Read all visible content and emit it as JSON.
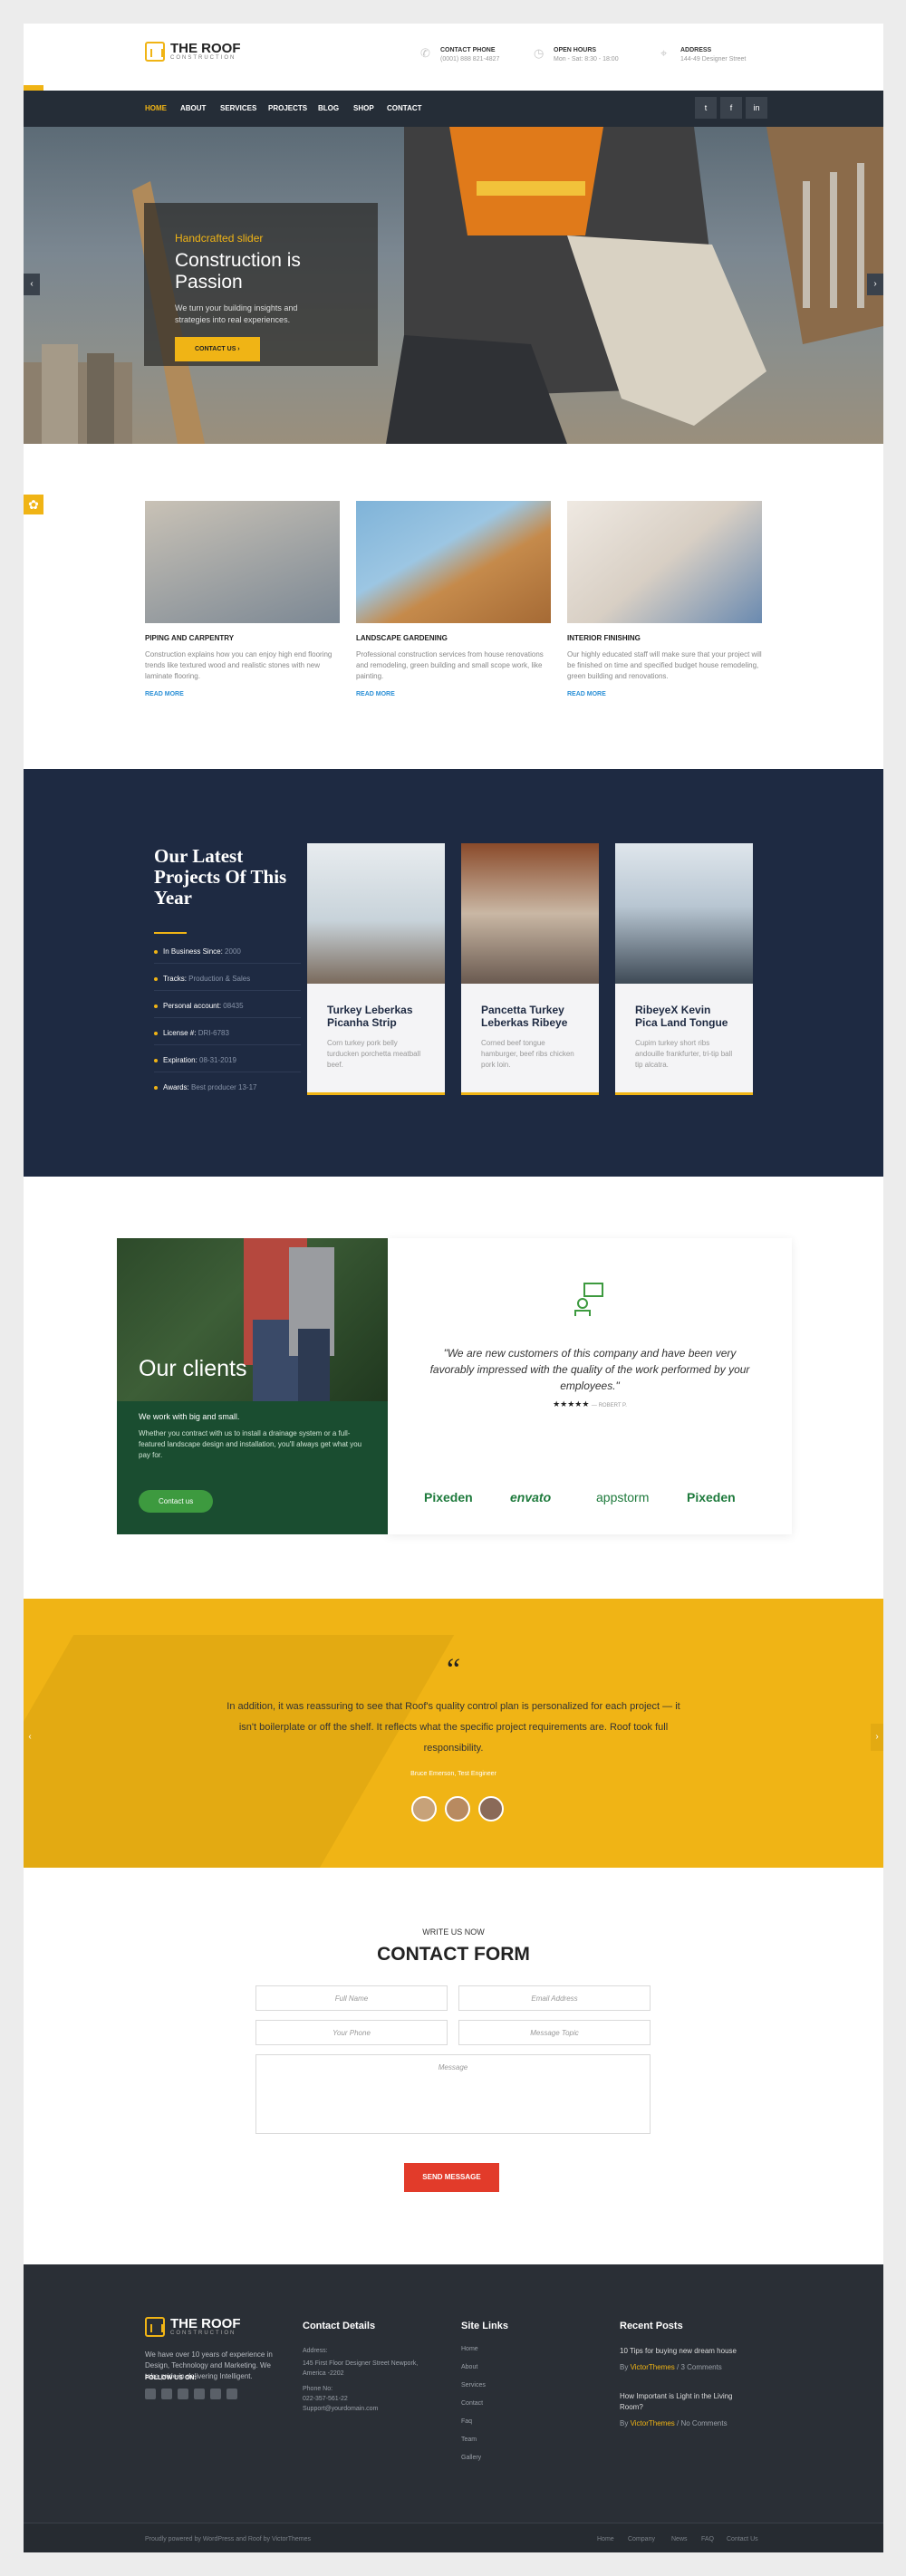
{
  "brand": {
    "name": "THE ROOF",
    "tagline": "CONSTRUCTION",
    "colors": {
      "accent": "#f0b415",
      "dark": "#252d37",
      "navy": "#1e2a42",
      "green": "#1a4d30",
      "red": "#e23b2a"
    }
  },
  "topinfo": [
    {
      "icon": "phone-icon",
      "label": "CONTACT PHONE",
      "value": "(0001) 888 821-4827"
    },
    {
      "icon": "clock-icon",
      "label": "OPEN HOURS",
      "value": "Mon - Sat: 8:30 - 18:00"
    },
    {
      "icon": "location-icon",
      "label": "ADDRESS",
      "value": "144-49 Designer Street"
    }
  ],
  "nav": {
    "items": [
      "HOME",
      "ABOUT",
      "SERVICES",
      "PROJECTS",
      "BLOG",
      "SHOP",
      "CONTACT"
    ],
    "active": "HOME",
    "social": [
      "twitter-icon",
      "facebook-icon",
      "linkedin-icon"
    ]
  },
  "hero": {
    "subtitle": "Handcrafted slider",
    "title": "Construction is Passion",
    "text": "We turn your building insights and strategies into real experiences.",
    "button": "CONTACT US ›"
  },
  "services": [
    {
      "title": "PIPING AND CARPENTRY",
      "text": "Construction explains how you can enjoy high end flooring trends like textured wood and realistic stones with new laminate flooring.",
      "more": "READ MORE"
    },
    {
      "title": "LANDSCAPE GARDENING",
      "text": "Professional construction services from house renovations and remodeling, green building and small scope work, like painting.",
      "more": "READ MORE"
    },
    {
      "title": "INTERIOR FINISHING",
      "text": "Our highly educated staff will make sure that your project will be finished on time and specified budget house remodeling, green building and renovations.",
      "more": "READ MORE"
    }
  ],
  "projects": {
    "title": "Our Latest Projects Of This Year",
    "stats": [
      {
        "label": "In Business Since:",
        "value": "2000"
      },
      {
        "label": "Tracks:",
        "value": "Production & Sales"
      },
      {
        "label": "Personal account:",
        "value": "08435"
      },
      {
        "label": "License #:",
        "value": "DRI-6783"
      },
      {
        "label": "Expiration:",
        "value": "08-31-2019"
      },
      {
        "label": "Awards:",
        "value": "Best producer 13-17"
      }
    ],
    "cards": [
      {
        "title": "Turkey Leberkas Picanha Strip",
        "text": "Corn turkey pork belly turducken porchetta meatball beef."
      },
      {
        "title": "Pancetta Turkey Leberkas Ribeye",
        "text": "Corned beef tongue hamburger, beef ribs chicken pork loin."
      },
      {
        "title": "RibeyeX Kevin Pica Land Tongue",
        "text": "Cupim turkey short ribs andouille frankfurter, tri-tip ball tip alcatra."
      }
    ]
  },
  "clients": {
    "title": "Our clients",
    "subtitle": "We work with big and small.",
    "text": "Whether you contract with us to install a drainage system or a full-featured landscape design and installation, you'll always get what you pay for.",
    "button": "Contact us",
    "quote": "\"We are new customers of this company and have been very favorably impressed with the quality of the work performed by your employees.\"",
    "stars": "★★★★★",
    "author": "— ROBERT P.",
    "logos": [
      "Pixeden",
      "envato",
      "appstorm",
      "Pixeden"
    ]
  },
  "testimonial": {
    "mark": "“",
    "text": "In addition, it was reassuring to see that Roof's quality control plan is personalized for each project — it isn't boilerplate or off the shelf. It reflects what the specific project requirements are. Roof took full responsibility.",
    "name": "Bruce Emerson, Test Engineer"
  },
  "contact": {
    "subtitle": "WRITE US NOW",
    "title": "CONTACT FORM",
    "fields": {
      "name": "Full Name",
      "email": "Email Address",
      "phone": "Your Phone",
      "topic": "Message Topic",
      "message": "Message"
    },
    "button": "SEND MESSAGE"
  },
  "footer": {
    "about": "We have over 10 years of experience in Design, Technology and Marketing. We take pride in delivering Intelligent.",
    "follow": "FOLLOW US ON:",
    "contact_title": "Contact Details",
    "address_label": "Address:",
    "address": "145 First Floor Designer Street Newpork, America -2202",
    "phone_label": "Phone No:",
    "phone": "022-357-561-22",
    "email": "Support@yourdomain.com",
    "links_title": "Site Links",
    "links": [
      "Home",
      "About",
      "Services",
      "Contact",
      "Faq",
      "Team",
      "Gallery"
    ],
    "posts_title": "Recent Posts",
    "posts": [
      {
        "title": "10 Tips for buying new dream house",
        "by": "By",
        "author": "VictorThemes",
        "comments": "/ 3 Comments"
      },
      {
        "title": "How Important is Light in the Living Room?",
        "by": "By",
        "author": "VictorThemes",
        "comments": "/ No Comments"
      }
    ],
    "copyright": "Proudly powered by WordPress and Roof by VictorThemes",
    "bottom_links": [
      "Home",
      "Company",
      "News",
      "FAQ",
      "Contact Us"
    ]
  }
}
